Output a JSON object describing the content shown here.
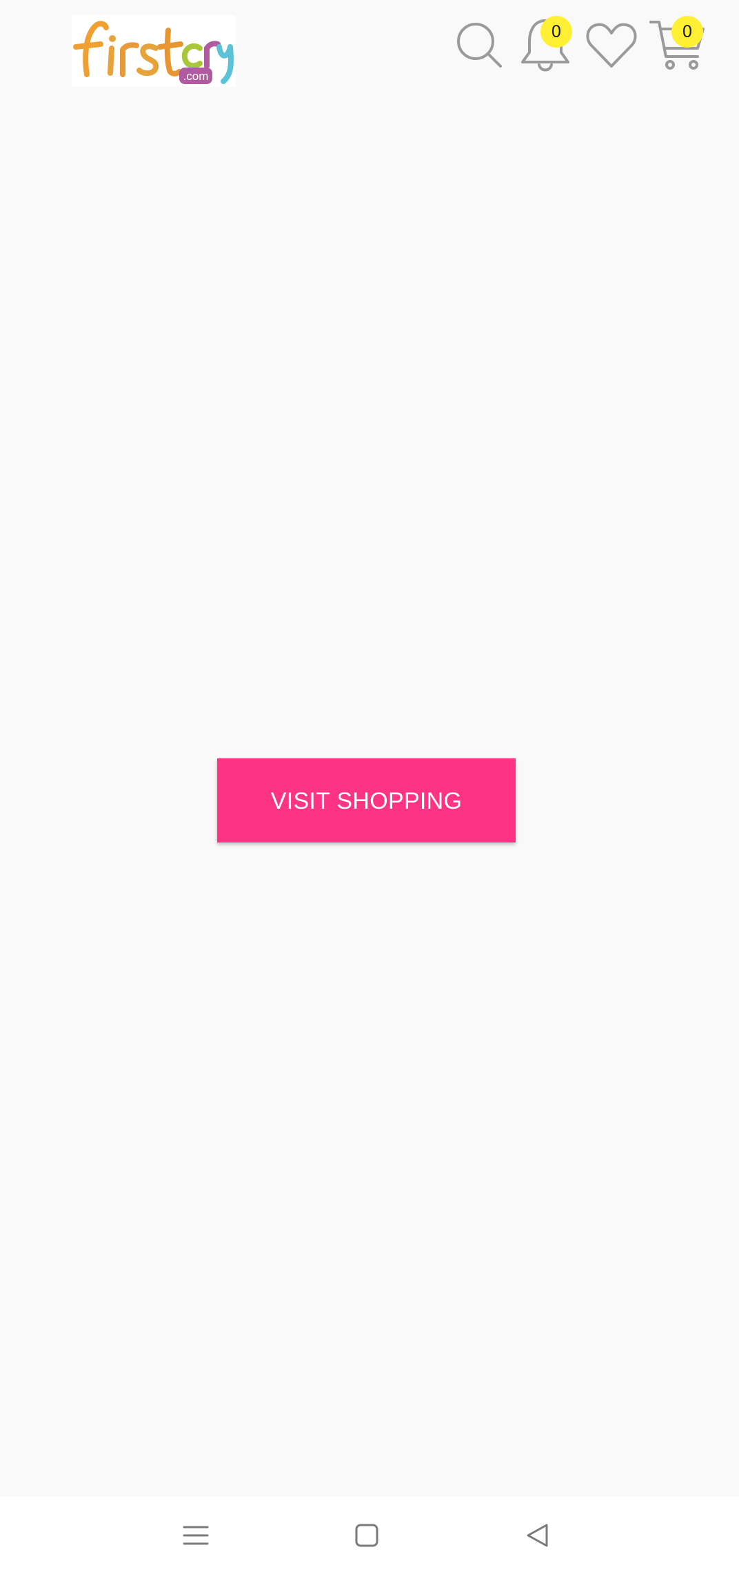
{
  "app": {
    "brand": {
      "logo_text": "firstcry",
      "logo_suffix": ".com",
      "colors": {
        "f": "#f0a030",
        "i": "#e8a23a",
        "r": "#e89a38",
        "s": "#e8a23a",
        "t": "#e89632",
        "c": "#a8c83a",
        "r2": "#b05aa0",
        "y": "#5bc2d8",
        "suffix_bg": "#b05aa0"
      }
    }
  },
  "header": {
    "icons": [
      "search-icon",
      "bell-icon",
      "heart-icon",
      "cart-icon"
    ],
    "notification_count": "0",
    "cart_count": "0",
    "badge_color": "#fff033"
  },
  "main": {
    "visit_button_label": "VISIT SHOPPING",
    "accent_color": "#ff3383"
  },
  "system_nav": {
    "icons": [
      "menu-icon",
      "home-icon",
      "back-icon"
    ]
  }
}
